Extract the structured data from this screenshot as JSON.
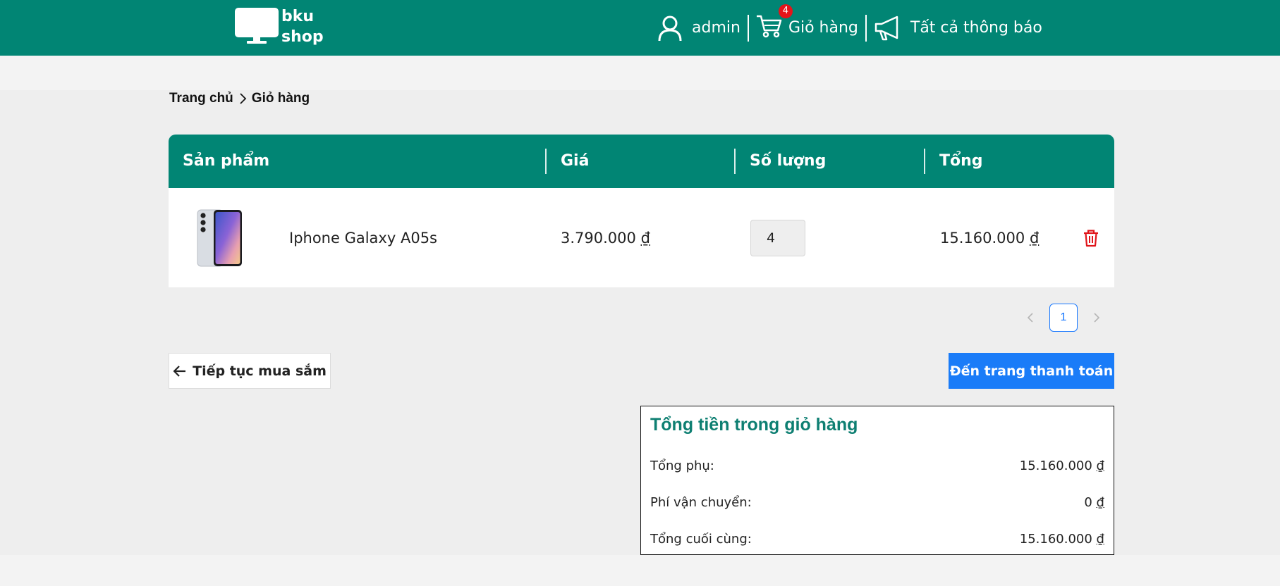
{
  "header": {
    "logo_line1": "bku",
    "logo_line2": "shop",
    "user_label": "admin",
    "cart_label": "Giỏ hàng",
    "cart_count": "4",
    "notifications_label": "Tất cả thông báo",
    "bg_color": "#018574"
  },
  "breadcrumb": {
    "home": "Trang chủ",
    "current": "Giỏ hàng"
  },
  "table": {
    "headers": [
      "Sản phẩm",
      "Giá",
      "Số lượng",
      "Tổng"
    ],
    "rows": [
      {
        "product_name": "Iphone Galaxy A05s",
        "price": "3.790.000",
        "quantity": "4",
        "total": "15.160.000",
        "currency": "₫"
      }
    ]
  },
  "pagination": {
    "current_page": "1",
    "prev_icon": "chevron-left-icon",
    "next_icon": "chevron-right-icon"
  },
  "actions": {
    "continue_label": "Tiếp tục mua sắm",
    "checkout_label": "Đến trang thanh toán",
    "checkout_color": "#1a7cf8"
  },
  "totals": {
    "title": "Tổng tiền trong giỏ hàng",
    "subtotal_label": "Tổng phụ:",
    "subtotal_value": "15.160.000",
    "shipping_label": "Phí vận chuyển:",
    "shipping_value": "0",
    "final_label": "Tổng cuối cùng:",
    "final_value": "15.160.000",
    "currency": "₫",
    "title_color": "#0e7f72"
  }
}
